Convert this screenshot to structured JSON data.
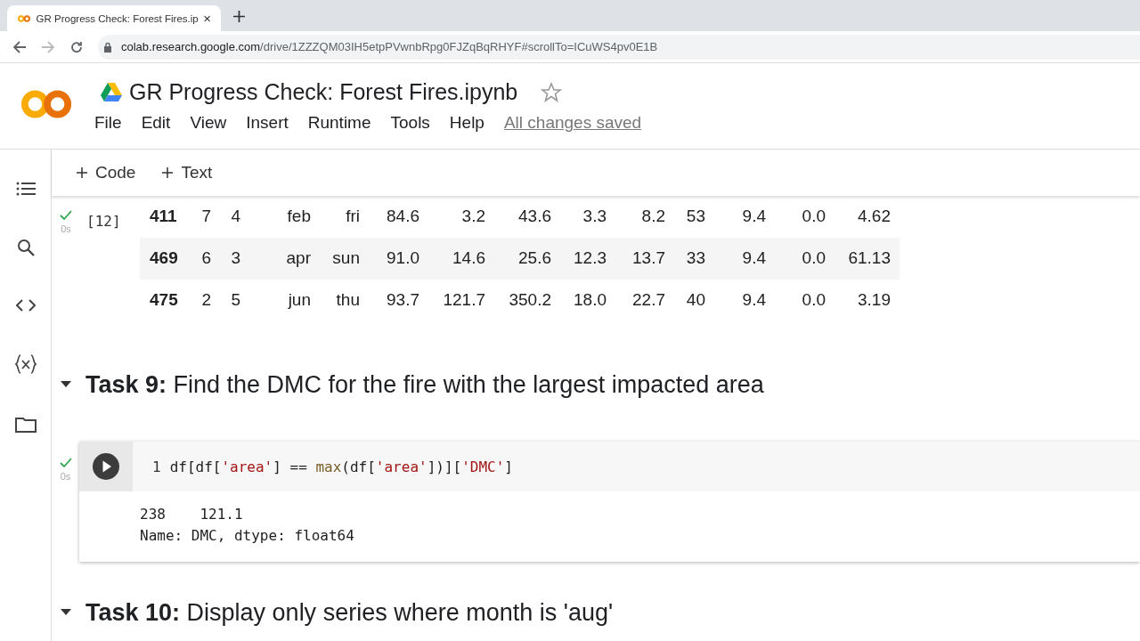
{
  "browser": {
    "tab_title": "GR Progress Check: Forest Fires.ip",
    "url_host": "colab.research.google.com",
    "url_path": "/drive/1ZZZQM03IH5etpPVwnbRpg0FJZqBqRHYF#scrollTo=ICuWS4pv0E1B"
  },
  "notebook": {
    "title": "GR Progress Check: Forest Fires.ipynb",
    "menus": [
      "File",
      "Edit",
      "View",
      "Insert",
      "Runtime",
      "Tools",
      "Help"
    ],
    "save_status": "All changes saved"
  },
  "toolbar": [
    "Code",
    "Text"
  ],
  "output_cell": {
    "exec_count": "[12]",
    "run_time": "0s",
    "rows": [
      {
        "cells": [
          "411",
          "7",
          "4",
          "feb",
          "fri",
          "84.6",
          "3.2",
          "43.6",
          "3.3",
          "8.2",
          "53",
          "9.4",
          "0.0",
          "4.62"
        ]
      },
      {
        "cells": [
          "469",
          "6",
          "3",
          "apr",
          "sun",
          "91.0",
          "14.6",
          "25.6",
          "12.3",
          "13.7",
          "33",
          "9.4",
          "0.0",
          "61.13"
        ]
      },
      {
        "cells": [
          "475",
          "2",
          "5",
          "jun",
          "thu",
          "93.7",
          "121.7",
          "350.2",
          "18.0",
          "22.7",
          "40",
          "9.4",
          "0.0",
          "3.19"
        ]
      }
    ]
  },
  "sections": [
    {
      "bold": "Task 9:",
      "text": " Find the DMC for the fire with the largest impacted area",
      "expanded": true
    },
    {
      "bold": "Task 10:",
      "text": " Display only series where month is 'aug'",
      "expanded": true
    }
  ],
  "code_cell": {
    "run_time": "0s",
    "line_number": "1",
    "tokens": [
      {
        "kind": "plain",
        "text": "df[df["
      },
      {
        "kind": "string",
        "text": "'area'"
      },
      {
        "kind": "plain",
        "text": "] == "
      },
      {
        "kind": "builtin",
        "text": "max"
      },
      {
        "kind": "plain",
        "text": "(df["
      },
      {
        "kind": "string",
        "text": "'area'"
      },
      {
        "kind": "plain",
        "text": "])]["
      },
      {
        "kind": "string",
        "text": "'DMC'"
      },
      {
        "kind": "plain",
        "text": "]"
      }
    ],
    "output": [
      "238    121.1",
      "Name: DMC, dtype: float64"
    ]
  }
}
